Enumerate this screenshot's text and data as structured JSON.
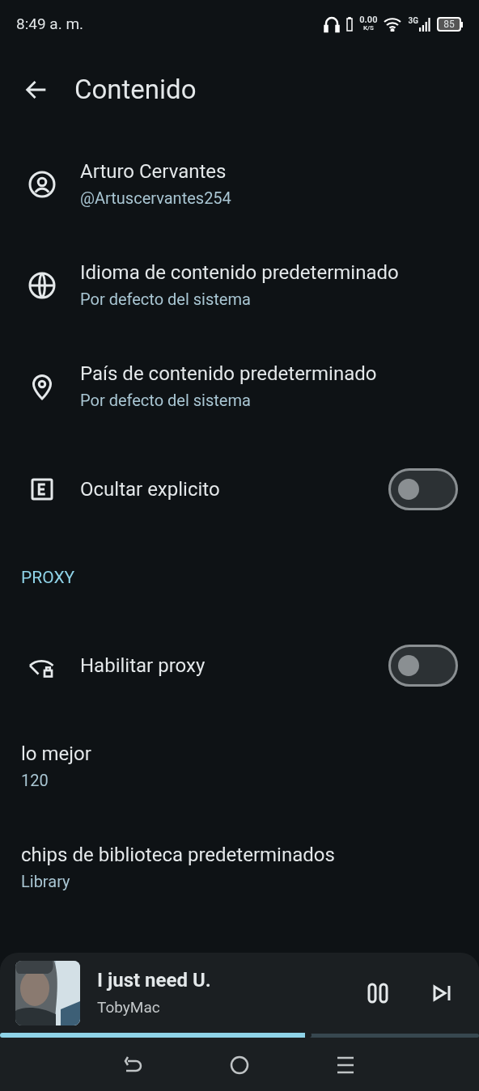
{
  "status_bar": {
    "time": "8:49 a. m.",
    "speed_value": "0.00",
    "speed_unit": "K/S",
    "network": "3G",
    "battery": "85"
  },
  "header": {
    "title": "Contenido"
  },
  "settings": [
    {
      "kind": "info",
      "title": "Arturo Cervantes",
      "subtitle": "@Artuscervantes254"
    },
    {
      "kind": "info",
      "title": "Idioma de contenido predeterminado",
      "subtitle": "Por defecto del sistema"
    },
    {
      "kind": "info",
      "title": "País de contenido predeterminado",
      "subtitle": "Por defecto del sistema"
    },
    {
      "kind": "toggle",
      "title": "Ocultar explicito",
      "on": false
    },
    {
      "kind": "section",
      "title": "PROXY"
    },
    {
      "kind": "toggle",
      "title": "Habilitar proxy",
      "on": false
    },
    {
      "kind": "info",
      "title": "lo mejor",
      "subtitle": "120"
    },
    {
      "kind": "info",
      "title": "chips de biblioteca predeterminados",
      "subtitle": "Library"
    }
  ],
  "player": {
    "title": "I just need U.",
    "artist": "TobyMac",
    "playing": true,
    "level": 0.65
  }
}
